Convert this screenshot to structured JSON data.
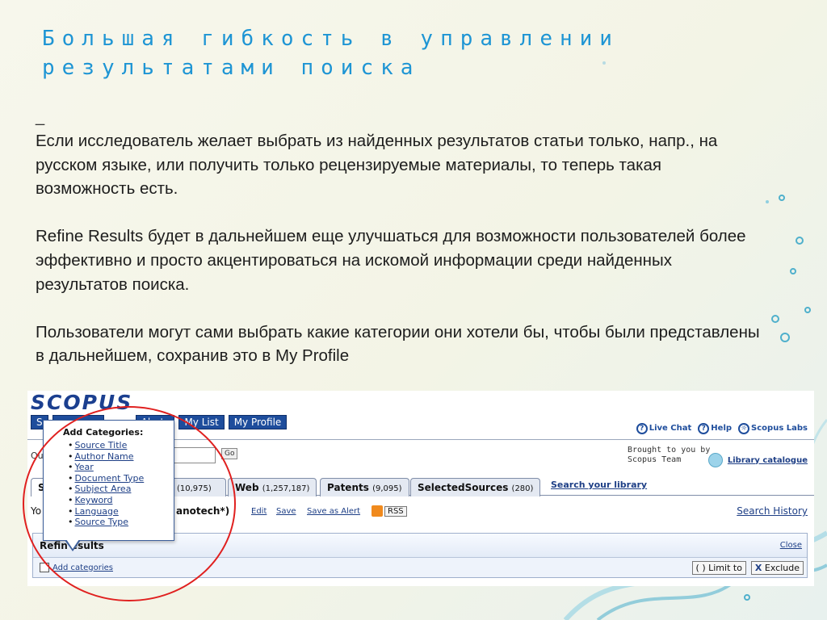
{
  "slide": {
    "title": "Большая гибкость в управлении результатами поиска",
    "dash": "_",
    "paragraphs": [
      "Если исследователь желает выбрать из найденных результатов статьи только, напр., на русском языке, или получить только рецензируемые материалы, то теперь такая возможность есть.",
      "Refine Results будет в дальнейшем еще улучшаться  для возможности пользователей более эффективно и просто акцентироваться на искомой информации среди найденных результатов поиска.",
      "Пользователи могут сами выбрать какие категории они хотели бы, чтобы были представлены в дальнейшем, сохранив это в My Profile"
    ]
  },
  "scopus": {
    "logo": "SCOPUS",
    "nav": {
      "search_frag": "S",
      "alerts": "Alerts",
      "my_list": "My List",
      "my_profile": "My Profile"
    },
    "top_links": {
      "live_chat": "Live Chat",
      "help": "Help",
      "scopus_labs": "Scopus Labs"
    },
    "quick_search_frag": "Qu",
    "go_label": "Go",
    "brought_by": "Brought to you by",
    "scopus_team": "Scopus Team",
    "library_catalogue": "Library catalogue",
    "tabs": [
      {
        "frag": "S",
        "label": "",
        "count": ""
      },
      {
        "frag": "",
        "label": "",
        "count": "(10,975)"
      },
      {
        "frag": "",
        "label": "Web",
        "count": "(1,257,187)"
      },
      {
        "frag": "",
        "label": "Patents",
        "count": "(9,095)"
      },
      {
        "frag": "",
        "label": "SelectedSources",
        "count": "(280)"
      }
    ],
    "search_your_library": "Search your library",
    "results": {
      "frag": "Yo",
      "query_frag": "anotech*)",
      "edit": "Edit",
      "save": "Save",
      "save_as_alert": "Save as Alert",
      "rss": "RSS",
      "search_history": "Search History"
    },
    "refine": {
      "title": "Refin   esults",
      "close": "Close",
      "add_categories": "Add categories",
      "limit_to": "Limit to",
      "exclude": "Exclude"
    },
    "popup": {
      "title": "Add Categories:",
      "items": [
        "Source Title",
        "Author Name",
        "Year",
        "Document Type",
        "Subject Area",
        "Keyword",
        "Language",
        "Source Type"
      ]
    }
  }
}
